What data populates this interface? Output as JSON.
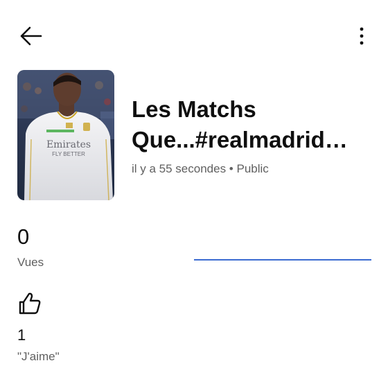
{
  "header": {
    "back_icon": "arrow-left-icon",
    "more_icon": "more-vertical-icon"
  },
  "video": {
    "title_line1": "Les Matchs",
    "title_line2": "Que...#realmadrid…",
    "meta": "il y a 55 secondes • Public",
    "thumbnail_alt": "Player in white Real Madrid jersey",
    "jersey_text_line1": "Emirates",
    "jersey_text_line2": "FLY BETTER"
  },
  "stats": {
    "views_count": "0",
    "views_label": "Vues",
    "likes_icon": "thumbs-up-icon",
    "likes_count": "1",
    "likes_label": "\"J'aime\""
  },
  "colors": {
    "accent_line": "#3b6bd1",
    "secondary_text": "#606060"
  }
}
